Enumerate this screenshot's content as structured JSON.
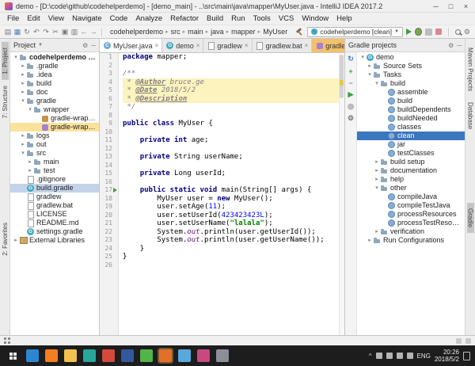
{
  "window": {
    "title": "demo - [D:\\code\\github\\codehelperdemo] - [demo_main] - ..\\src\\main\\java\\mapper\\MyUser.java - IntelliJ IDEA 2017.2",
    "controls": {
      "minimize": "─",
      "maximize": "□",
      "close": "×"
    }
  },
  "menu_items": [
    "File",
    "Edit",
    "View",
    "Navigate",
    "Code",
    "Analyze",
    "Refactor",
    "Build",
    "Run",
    "Tools",
    "VCS",
    "Window",
    "Help"
  ],
  "toolbar": {
    "left_icons": [
      "open",
      "save",
      "sync",
      "undo",
      "redo",
      "cut",
      "copy",
      "paste",
      "back",
      "forward"
    ],
    "breadcrumbs": [
      "codehelperdemo",
      "src",
      "main",
      "java",
      "mapper",
      "MyUser"
    ],
    "run_config": "codehelperdemo [clean]"
  },
  "left_stripe": [
    "1: Project",
    "7: Structure",
    "2: Favorites"
  ],
  "right_stripe": [
    {
      "label": "Maven Projects",
      "active": false
    },
    {
      "label": "Database",
      "active": false
    },
    {
      "label": "Gradle",
      "active": true
    }
  ],
  "project_panel": {
    "header": "Project",
    "tree": [
      {
        "label": "codehelperdemo [demo]",
        "level": 0,
        "icon": "folder",
        "arrow": "open",
        "bold": true
      },
      {
        "label": ".gradle",
        "level": 1,
        "icon": "folder",
        "arrow": "closed"
      },
      {
        "label": ".idea",
        "level": 1,
        "icon": "folder",
        "arrow": "closed"
      },
      {
        "label": "build",
        "level": 1,
        "icon": "folder",
        "arrow": "closed"
      },
      {
        "label": "doc",
        "level": 1,
        "icon": "folder",
        "arrow": "closed"
      },
      {
        "label": "gradle",
        "level": 1,
        "icon": "folder",
        "arrow": "open"
      },
      {
        "label": "wrapper",
        "level": 2,
        "icon": "folder",
        "arrow": "open"
      },
      {
        "label": "gradle-wrapper.jar",
        "level": 3,
        "icon": "jar",
        "arrow": "none"
      },
      {
        "label": "gradle-wrapper.properties",
        "level": 3,
        "icon": "props",
        "arrow": "none",
        "highlight": true
      },
      {
        "label": "logs",
        "level": 1,
        "icon": "folder",
        "arrow": "closed"
      },
      {
        "label": "out",
        "level": 1,
        "icon": "folder",
        "arrow": "closed"
      },
      {
        "label": "src",
        "level": 1,
        "icon": "folder",
        "arrow": "open"
      },
      {
        "label": "main",
        "level": 2,
        "icon": "folder",
        "arrow": "closed"
      },
      {
        "label": "test",
        "level": 2,
        "icon": "folder",
        "arrow": "closed"
      },
      {
        "label": ".gitignore",
        "level": 1,
        "icon": "file",
        "arrow": "none"
      },
      {
        "label": "build.gradle",
        "level": 1,
        "icon": "gradle",
        "arrow": "none",
        "selected": true
      },
      {
        "label": "gradlew",
        "level": 1,
        "icon": "file",
        "arrow": "none"
      },
      {
        "label": "gradlew.bat",
        "level": 1,
        "icon": "file",
        "arrow": "none"
      },
      {
        "label": "LICENSE",
        "level": 1,
        "icon": "file",
        "arrow": "none"
      },
      {
        "label": "README.md",
        "level": 1,
        "icon": "file",
        "arrow": "none"
      },
      {
        "label": "settings.gradle",
        "level": 1,
        "icon": "gradle",
        "arrow": "none"
      },
      {
        "label": "External Libraries",
        "level": 0,
        "icon": "lib",
        "arrow": "closed"
      }
    ]
  },
  "editor": {
    "tabs": [
      {
        "label": "MyUser.java",
        "icon": "class",
        "active": true
      },
      {
        "label": "demo",
        "icon": "gradle",
        "active": false
      },
      {
        "label": "gradlew",
        "icon": "file",
        "active": false
      },
      {
        "label": "gradlew.bat",
        "icon": "file",
        "active": false
      },
      {
        "label": "gradle-wrapper.properties",
        "icon": "props",
        "active": false,
        "highlight": true
      }
    ],
    "close_glyph": "×",
    "highlight_lines": [
      4,
      5,
      6
    ],
    "run_gutter_line": 17,
    "lines": [
      {
        "n": 1,
        "t": [
          [
            "k",
            "package"
          ],
          [
            "p",
            " mapper;"
          ]
        ]
      },
      {
        "n": 2,
        "t": []
      },
      {
        "n": 3,
        "t": [
          [
            "c",
            "/**"
          ]
        ]
      },
      {
        "n": 4,
        "t": [
          [
            "c",
            " * "
          ],
          [
            "ct",
            "@Author"
          ],
          [
            "c",
            " bruce.ge"
          ]
        ]
      },
      {
        "n": 5,
        "t": [
          [
            "c",
            " * "
          ],
          [
            "ct",
            "@Date"
          ],
          [
            "c",
            " 2018/5/2"
          ]
        ]
      },
      {
        "n": 6,
        "t": [
          [
            "c",
            " * "
          ],
          [
            "ct",
            "@Description"
          ]
        ]
      },
      {
        "n": 7,
        "t": [
          [
            "c",
            " */"
          ]
        ]
      },
      {
        "n": 8,
        "t": []
      },
      {
        "n": 9,
        "t": [
          [
            "k",
            "public class"
          ],
          [
            "p",
            " MyUser {"
          ]
        ]
      },
      {
        "n": 10,
        "t": []
      },
      {
        "n": 11,
        "t": [
          [
            "p",
            "    "
          ],
          [
            "k",
            "private int"
          ],
          [
            "p",
            " age;"
          ]
        ]
      },
      {
        "n": 12,
        "t": []
      },
      {
        "n": 13,
        "t": [
          [
            "p",
            "    "
          ],
          [
            "k",
            "private"
          ],
          [
            "p",
            " String userName;"
          ]
        ]
      },
      {
        "n": 14,
        "t": []
      },
      {
        "n": 15,
        "t": [
          [
            "p",
            "    "
          ],
          [
            "k",
            "private"
          ],
          [
            "p",
            " Long userId;"
          ]
        ]
      },
      {
        "n": 16,
        "t": []
      },
      {
        "n": 17,
        "t": [
          [
            "p",
            "    "
          ],
          [
            "k",
            "public static void"
          ],
          [
            "p",
            " main(String[] args) {"
          ]
        ]
      },
      {
        "n": 18,
        "t": [
          [
            "p",
            "        MyUser user = "
          ],
          [
            "k",
            "new"
          ],
          [
            "p",
            " MyUser();"
          ]
        ]
      },
      {
        "n": 19,
        "t": [
          [
            "p",
            "        user.setAge("
          ],
          [
            "num",
            "11"
          ],
          [
            "p",
            ");"
          ]
        ]
      },
      {
        "n": 20,
        "t": [
          [
            "p",
            "        user.setUserId("
          ],
          [
            "num",
            "423423423L"
          ],
          [
            "p",
            ");"
          ]
        ]
      },
      {
        "n": 21,
        "t": [
          [
            "p",
            "        user.setUserName("
          ],
          [
            "s",
            "\"lalala\""
          ],
          [
            "p",
            ");"
          ]
        ]
      },
      {
        "n": 22,
        "t": [
          [
            "p",
            "        System."
          ],
          [
            "f",
            "out"
          ],
          [
            "p",
            ".println(user.getUserId());"
          ]
        ]
      },
      {
        "n": 23,
        "t": [
          [
            "p",
            "        System."
          ],
          [
            "f",
            "out"
          ],
          [
            "p",
            ".println(user.getUserName());"
          ]
        ]
      },
      {
        "n": 24,
        "t": [
          [
            "p",
            "    }"
          ]
        ]
      },
      {
        "n": 25,
        "t": [
          [
            "p",
            "}"
          ]
        ]
      },
      {
        "n": 26,
        "t": []
      }
    ]
  },
  "gradle_panel": {
    "header": "Gradle projects",
    "toolbar_icons": [
      "refresh",
      "attach",
      "detach",
      "run-task",
      "offline",
      "gradle-settings"
    ],
    "tree": [
      {
        "label": "demo",
        "level": 0,
        "icon": "gradle",
        "arrow": "open"
      },
      {
        "label": "Source Sets",
        "level": 1,
        "icon": "folder",
        "arrow": "closed"
      },
      {
        "label": "Tasks",
        "level": 1,
        "icon": "folder",
        "arrow": "open"
      },
      {
        "label": "build",
        "level": 2,
        "icon": "folder",
        "arrow": "open"
      },
      {
        "label": "assemble",
        "level": 3,
        "icon": "task",
        "arrow": "none"
      },
      {
        "label": "build",
        "level": 3,
        "icon": "task",
        "arrow": "none"
      },
      {
        "label": "buildDependents",
        "level": 3,
        "icon": "task",
        "arrow": "none"
      },
      {
        "label": "buildNeeded",
        "level": 3,
        "icon": "task",
        "arrow": "none"
      },
      {
        "label": "classes",
        "level": 3,
        "icon": "task",
        "arrow": "none"
      },
      {
        "label": "clean",
        "level": 3,
        "icon": "task",
        "arrow": "none",
        "selected": true
      },
      {
        "label": "jar",
        "level": 3,
        "icon": "task",
        "arrow": "none"
      },
      {
        "label": "testClasses",
        "level": 3,
        "icon": "task",
        "arrow": "none"
      },
      {
        "label": "build setup",
        "level": 2,
        "icon": "folder",
        "arrow": "closed"
      },
      {
        "label": "documentation",
        "level": 2,
        "icon": "folder",
        "arrow": "closed"
      },
      {
        "label": "help",
        "level": 2,
        "icon": "folder",
        "arrow": "closed"
      },
      {
        "label": "other",
        "level": 2,
        "icon": "folder",
        "arrow": "open"
      },
      {
        "label": "compileJava",
        "level": 3,
        "icon": "task",
        "arrow": "none"
      },
      {
        "label": "compileTestJava",
        "level": 3,
        "icon": "task",
        "arrow": "none"
      },
      {
        "label": "processResources",
        "level": 3,
        "icon": "task",
        "arrow": "none"
      },
      {
        "label": "processTestResources",
        "level": 3,
        "icon": "task",
        "arrow": "none"
      },
      {
        "label": "verification",
        "level": 2,
        "icon": "folder",
        "arrow": "closed"
      },
      {
        "label": "Run Configurations",
        "level": 1,
        "icon": "folder",
        "arrow": "closed"
      }
    ]
  },
  "taskbar": {
    "apps": [
      {
        "name": "browser-blue",
        "color": "#2e86d3"
      },
      {
        "name": "firefox",
        "color": "#f57f20"
      },
      {
        "name": "file-explorer",
        "color": "#f2c14e"
      },
      {
        "name": "app-teal",
        "color": "#27a79a"
      },
      {
        "name": "app-red",
        "color": "#d24a3b"
      },
      {
        "name": "app-navy",
        "color": "#34589c"
      },
      {
        "name": "app-green",
        "color": "#52b54b"
      },
      {
        "name": "app-orange",
        "color": "#e2702a",
        "active": true
      },
      {
        "name": "app-skyblue",
        "color": "#58a8dd"
      },
      {
        "name": "intellij-idea",
        "color": "#c8497e"
      },
      {
        "name": "app-gray",
        "color": "#8a8f98"
      }
    ],
    "tray": {
      "lang": "ENG",
      "time": "20:26",
      "date": "2018/5/2"
    }
  },
  "colors": {
    "selection_focus": "#3c76bf",
    "selection_unfocus": "#c3d4e8",
    "amber_highlight": "#fbe29b",
    "editor_line_highlight": "#fdf3bf",
    "keyword": "#000080",
    "string": "#008000",
    "accent": "#4a88c7"
  }
}
